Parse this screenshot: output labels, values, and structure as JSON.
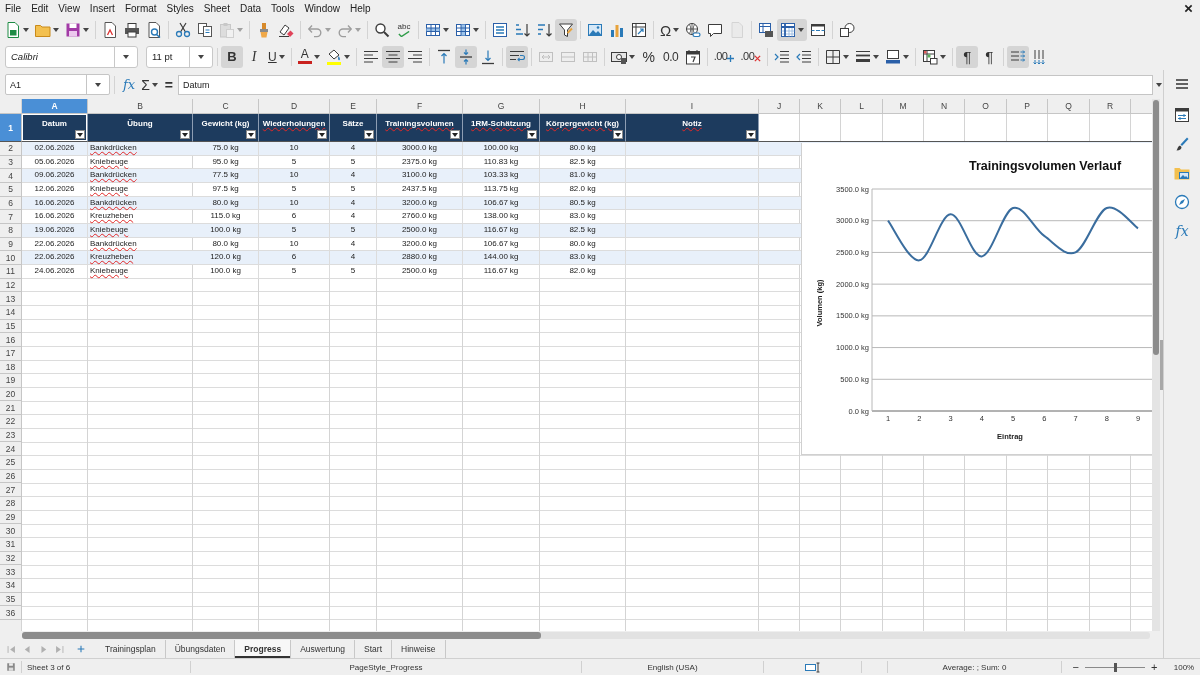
{
  "menu_bar": [
    "File",
    "Edit",
    "View",
    "Insert",
    "Format",
    "Styles",
    "Sheet",
    "Data",
    "Tools",
    "Window",
    "Help"
  ],
  "standard_toolbar": [
    [
      {
        "kind": "new",
        "on": false,
        "disabled": false
      },
      {
        "kind": "open",
        "on": false,
        "disabled": false
      },
      {
        "kind": "save",
        "on": false,
        "disabled": false
      }
    ],
    [
      {
        "kind": "export_pdf",
        "on": false,
        "disabled": false
      },
      {
        "kind": "print",
        "on": false,
        "disabled": false
      },
      {
        "kind": "print_preview",
        "on": false,
        "disabled": false
      }
    ],
    [
      {
        "kind": "cut",
        "on": false,
        "disabled": false
      },
      {
        "kind": "copy",
        "on": false,
        "disabled": false
      },
      {
        "kind": "paste",
        "on": false,
        "disabled": true
      }
    ],
    [
      {
        "kind": "clone_formatting",
        "on": false,
        "disabled": false
      },
      {
        "kind": "clear_formatting",
        "on": false,
        "disabled": false
      }
    ],
    [
      {
        "kind": "undo",
        "on": false,
        "disabled": true
      },
      {
        "kind": "redo",
        "on": false,
        "disabled": true
      }
    ],
    [
      {
        "kind": "find_replace",
        "on": false,
        "disabled": false
      },
      {
        "kind": "spelling",
        "glyph": "abc",
        "on": false,
        "disabled": false
      }
    ],
    [
      {
        "kind": "row",
        "on": false,
        "disabled": false
      },
      {
        "kind": "column",
        "on": false,
        "disabled": false
      }
    ],
    [
      {
        "kind": "sort",
        "on": false,
        "disabled": false
      },
      {
        "kind": "sort_ascending",
        "on": false,
        "disabled": false
      },
      {
        "kind": "sort_descending",
        "on": false,
        "disabled": false
      },
      {
        "kind": "autofilter",
        "on": true,
        "disabled": false
      }
    ],
    [
      {
        "kind": "image",
        "on": false,
        "disabled": false
      },
      {
        "kind": "chart",
        "on": false,
        "disabled": false
      },
      {
        "kind": "pivot_table",
        "on": false,
        "disabled": false
      }
    ],
    [
      {
        "kind": "special_character",
        "glyph": "Ω",
        "on": false,
        "disabled": false
      },
      {
        "kind": "hyperlink",
        "on": false,
        "disabled": false
      },
      {
        "kind": "comment",
        "on": false,
        "disabled": false
      },
      {
        "kind": "header_footer",
        "on": false,
        "disabled": true
      }
    ],
    [
      {
        "kind": "print_area",
        "on": false,
        "disabled": false
      },
      {
        "kind": "freeze",
        "on": true,
        "disabled": false
      },
      {
        "kind": "split_window",
        "on": false,
        "disabled": false
      }
    ],
    [
      {
        "kind": "draw_functions",
        "on": false,
        "disabled": false
      }
    ]
  ],
  "formatting_toolbar": {
    "font_name": "Calibri",
    "font_size": "11 pt",
    "groups": [
      [
        {
          "kind": "bold",
          "glyph": "B",
          "on": true,
          "disabled": false
        },
        {
          "kind": "italic",
          "glyph": "I",
          "on": false,
          "disabled": false
        },
        {
          "kind": "underline",
          "glyph": "U",
          "on": false,
          "disabled": false
        }
      ],
      [
        {
          "kind": "font_color",
          "glyph": "A",
          "color": "#c9211e",
          "on": false,
          "disabled": false
        },
        {
          "kind": "highlight",
          "color": "#ffff00",
          "on": false,
          "disabled": false
        }
      ],
      [
        {
          "kind": "align_left",
          "on": false,
          "disabled": false
        },
        {
          "kind": "align_center",
          "on": true,
          "disabled": false
        },
        {
          "kind": "align_right",
          "on": false,
          "disabled": false
        }
      ],
      [
        {
          "kind": "align_top",
          "on": false,
          "disabled": false
        },
        {
          "kind": "align_middle",
          "on": true,
          "disabled": false
        },
        {
          "kind": "align_bottom",
          "on": false,
          "disabled": false
        }
      ],
      [
        {
          "kind": "wrap_text",
          "on": true,
          "disabled": false
        }
      ],
      [
        {
          "kind": "merge_center",
          "on": false,
          "disabled": true
        },
        {
          "kind": "merge",
          "on": false,
          "disabled": true
        },
        {
          "kind": "unmerge",
          "on": false,
          "disabled": true
        }
      ],
      [
        {
          "kind": "number_format",
          "on": false,
          "disabled": false
        },
        {
          "kind": "percent",
          "glyph": "%",
          "on": false,
          "disabled": false
        },
        {
          "kind": "number",
          "glyph": "0.0",
          "on": false,
          "disabled": false
        },
        {
          "kind": "date",
          "on": false,
          "disabled": false
        }
      ],
      [
        {
          "kind": "add_decimal",
          "glyph": ".00",
          "on": false,
          "disabled": false
        },
        {
          "kind": "delete_decimal",
          "glyph": ".00",
          "on": false,
          "disabled": false
        }
      ],
      [
        {
          "kind": "indent",
          "on": false,
          "disabled": false
        },
        {
          "kind": "outdent",
          "on": false,
          "disabled": false
        }
      ],
      [
        {
          "kind": "borders",
          "on": false,
          "disabled": false
        },
        {
          "kind": "border_style",
          "on": false,
          "disabled": false
        },
        {
          "kind": "border_color",
          "on": false,
          "disabled": false
        }
      ],
      [
        {
          "kind": "conditional",
          "on": false,
          "disabled": false
        }
      ],
      [
        {
          "kind": "ltr",
          "glyph": "¶",
          "on": true,
          "disabled": false
        },
        {
          "kind": "rtl",
          "glyph": "¶",
          "on": false,
          "disabled": false
        }
      ],
      [
        {
          "kind": "text_horizontal",
          "on": true,
          "disabled": false
        },
        {
          "kind": "text_vertical",
          "on": false,
          "disabled": false
        }
      ]
    ]
  },
  "formula_bar": {
    "cell_reference": "A1",
    "function_wizard": "fx",
    "sum": "Σ",
    "formula": "=",
    "content": "Datum"
  },
  "sheet": {
    "columns": [
      {
        "letter": "A",
        "selected": true
      },
      {
        "letter": "B",
        "selected": false
      },
      {
        "letter": "C",
        "selected": false
      },
      {
        "letter": "D",
        "selected": false
      },
      {
        "letter": "E",
        "selected": false
      },
      {
        "letter": "F",
        "selected": false
      },
      {
        "letter": "G",
        "selected": false
      },
      {
        "letter": "H",
        "selected": false
      },
      {
        "letter": "I",
        "selected": false
      },
      {
        "letter": "J",
        "selected": false
      },
      {
        "letter": "K",
        "selected": false
      },
      {
        "letter": "L",
        "selected": false
      },
      {
        "letter": "M",
        "selected": false
      },
      {
        "letter": "N",
        "selected": false
      },
      {
        "letter": "O",
        "selected": false
      },
      {
        "letter": "P",
        "selected": false
      },
      {
        "letter": "Q",
        "selected": false
      },
      {
        "letter": "R",
        "selected": false
      }
    ],
    "header_row": {
      "row_number": "1",
      "selected": true,
      "cells": [
        {
          "text": "Datum",
          "misspelled": false
        },
        {
          "text": "Übung",
          "misspelled": false
        },
        {
          "text": "Gewicht (kg)",
          "misspelled": false
        },
        {
          "text": "Wiederholungen",
          "misspelled": true
        },
        {
          "text": "Sätze",
          "misspelled": false
        },
        {
          "text": "Trainingsvolumen",
          "misspelled": true
        },
        {
          "text": "1RM-Schätzung",
          "misspelled": true
        },
        {
          "text": "Körpergewicht (kg)",
          "misspelled": true
        },
        {
          "text": "Notiz",
          "misspelled": true
        }
      ]
    },
    "rows": [
      {
        "row_number": "2",
        "cells": [
          {
            "text": "02.06.2026",
            "misspelled": false
          },
          {
            "text": "Bankdrücken",
            "misspelled": true
          },
          {
            "text": "75.0 kg",
            "misspelled": false
          },
          {
            "text": "10",
            "misspelled": false
          },
          {
            "text": "4",
            "misspelled": false
          },
          {
            "text": "3000.0 kg",
            "misspelled": false
          },
          {
            "text": "100.00 kg",
            "misspelled": false
          },
          {
            "text": "80.0 kg",
            "misspelled": false
          }
        ]
      },
      {
        "row_number": "3",
        "cells": [
          {
            "text": "05.06.2026",
            "misspelled": false
          },
          {
            "text": "Kniebeuge",
            "misspelled": true
          },
          {
            "text": "95.0 kg",
            "misspelled": false
          },
          {
            "text": "5",
            "misspelled": false
          },
          {
            "text": "5",
            "misspelled": false
          },
          {
            "text": "2375.0 kg",
            "misspelled": false
          },
          {
            "text": "110.83 kg",
            "misspelled": false
          },
          {
            "text": "82.5 kg",
            "misspelled": false
          }
        ]
      },
      {
        "row_number": "4",
        "cells": [
          {
            "text": "09.06.2026",
            "misspelled": false
          },
          {
            "text": "Bankdrücken",
            "misspelled": true
          },
          {
            "text": "77.5 kg",
            "misspelled": false
          },
          {
            "text": "10",
            "misspelled": false
          },
          {
            "text": "4",
            "misspelled": false
          },
          {
            "text": "3100.0 kg",
            "misspelled": false
          },
          {
            "text": "103.33 kg",
            "misspelled": false
          },
          {
            "text": "81.0 kg",
            "misspelled": false
          }
        ]
      },
      {
        "row_number": "5",
        "cells": [
          {
            "text": "12.06.2026",
            "misspelled": false
          },
          {
            "text": "Kniebeuge",
            "misspelled": true
          },
          {
            "text": "97.5 kg",
            "misspelled": false
          },
          {
            "text": "5",
            "misspelled": false
          },
          {
            "text": "5",
            "misspelled": false
          },
          {
            "text": "2437.5 kg",
            "misspelled": false
          },
          {
            "text": "113.75 kg",
            "misspelled": false
          },
          {
            "text": "82.0 kg",
            "misspelled": false
          }
        ]
      },
      {
        "row_number": "6",
        "cells": [
          {
            "text": "16.06.2026",
            "misspelled": false
          },
          {
            "text": "Bankdrücken",
            "misspelled": true
          },
          {
            "text": "80.0 kg",
            "misspelled": false
          },
          {
            "text": "10",
            "misspelled": false
          },
          {
            "text": "4",
            "misspelled": false
          },
          {
            "text": "3200.0 kg",
            "misspelled": false
          },
          {
            "text": "106.67 kg",
            "misspelled": false
          },
          {
            "text": "80.5 kg",
            "misspelled": false
          }
        ]
      },
      {
        "row_number": "7",
        "cells": [
          {
            "text": "16.06.2026",
            "misspelled": false
          },
          {
            "text": "Kreuzheben",
            "misspelled": true
          },
          {
            "text": "115.0 kg",
            "misspelled": false
          },
          {
            "text": "6",
            "misspelled": false
          },
          {
            "text": "4",
            "misspelled": false
          },
          {
            "text": "2760.0 kg",
            "misspelled": false
          },
          {
            "text": "138.00 kg",
            "misspelled": false
          },
          {
            "text": "83.0 kg",
            "misspelled": false
          }
        ]
      },
      {
        "row_number": "8",
        "cells": [
          {
            "text": "19.06.2026",
            "misspelled": false
          },
          {
            "text": "Kniebeuge",
            "misspelled": true
          },
          {
            "text": "100.0 kg",
            "misspelled": false
          },
          {
            "text": "5",
            "misspelled": false
          },
          {
            "text": "5",
            "misspelled": false
          },
          {
            "text": "2500.0 kg",
            "misspelled": false
          },
          {
            "text": "116.67 kg",
            "misspelled": false
          },
          {
            "text": "82.5 kg",
            "misspelled": false
          }
        ]
      },
      {
        "row_number": "9",
        "cells": [
          {
            "text": "22.06.2026",
            "misspelled": false
          },
          {
            "text": "Bankdrücken",
            "misspelled": true
          },
          {
            "text": "80.0 kg",
            "misspelled": false
          },
          {
            "text": "10",
            "misspelled": false
          },
          {
            "text": "4",
            "misspelled": false
          },
          {
            "text": "3200.0 kg",
            "misspelled": false
          },
          {
            "text": "106.67 kg",
            "misspelled": false
          },
          {
            "text": "80.0 kg",
            "misspelled": false
          }
        ]
      },
      {
        "row_number": "10",
        "cells": [
          {
            "text": "22.06.2026",
            "misspelled": false
          },
          {
            "text": "Kreuzheben",
            "misspelled": true
          },
          {
            "text": "120.0 kg",
            "misspelled": false
          },
          {
            "text": "6",
            "misspelled": false
          },
          {
            "text": "4",
            "misspelled": false
          },
          {
            "text": "2880.0 kg",
            "misspelled": false
          },
          {
            "text": "144.00 kg",
            "misspelled": false
          },
          {
            "text": "83.0 kg",
            "misspelled": false
          }
        ]
      },
      {
        "row_number": "11",
        "cells": [
          {
            "text": "24.06.2026",
            "misspelled": false
          },
          {
            "text": "Kniebeuge",
            "misspelled": true
          },
          {
            "text": "100.0 kg",
            "misspelled": false
          },
          {
            "text": "5",
            "misspelled": false
          },
          {
            "text": "5",
            "misspelled": false
          },
          {
            "text": "2500.0 kg",
            "misspelled": false
          },
          {
            "text": "116.67 kg",
            "misspelled": false
          },
          {
            "text": "82.0 kg",
            "misspelled": false
          }
        ]
      }
    ],
    "empty_row_numbers": [
      "12",
      "13",
      "14",
      "15",
      "16",
      "17",
      "18",
      "19",
      "20",
      "21",
      "22",
      "23",
      "24",
      "25",
      "26",
      "27",
      "28",
      "29",
      "30",
      "31",
      "32",
      "33",
      "34",
      "35",
      "36"
    ],
    "chart": {
      "chart_data": {
        "type": "line",
        "title": "Trainingsvolumen Verlauf",
        "xlabel": "Eintrag",
        "ylabel": "Volumen (kg)",
        "categories": [
          "1",
          "2",
          "3",
          "4",
          "5",
          "6",
          "7",
          "8",
          "9"
        ],
        "series": [
          {
            "color": "#3a6d9e",
            "values": [
              3000,
              2375,
              3100,
              2437.5,
              3200,
              2760,
              2500,
              3200,
              2880
            ]
          }
        ],
        "ylim": [
          0,
          3500
        ],
        "yticks": [
          {
            "value": 0,
            "label": "0.0 kg"
          },
          {
            "value": 500,
            "label": "500.0 kg"
          },
          {
            "value": 1000,
            "label": "1000.0 kg"
          },
          {
            "value": 1500,
            "label": "1500.0 kg"
          },
          {
            "value": 2000,
            "label": "2000.0 kg"
          },
          {
            "value": 2500,
            "label": "2500.0 kg"
          },
          {
            "value": 3000,
            "label": "3000.0 kg"
          },
          {
            "value": 3500,
            "label": "3500.0 kg"
          }
        ],
        "grid": true
      }
    }
  },
  "sheet_navigation": [
    {
      "kind": "first",
      "disabled": true
    },
    {
      "kind": "previous",
      "disabled": true
    },
    {
      "kind": "next",
      "disabled": true
    },
    {
      "kind": "last",
      "disabled": true
    }
  ],
  "sheet_tabs": [
    {
      "label": "Trainingsplan",
      "selected": false
    },
    {
      "label": "Übungsdaten",
      "selected": false
    },
    {
      "label": "Progress",
      "selected": true
    },
    {
      "label": "Auswertung",
      "selected": false
    },
    {
      "label": "Start",
      "selected": false
    },
    {
      "label": "Hinweise",
      "selected": false
    }
  ],
  "sidebar": {
    "decks": [
      {
        "kind": "properties"
      },
      {
        "kind": "styles"
      },
      {
        "kind": "gallery"
      },
      {
        "kind": "navigator"
      },
      {
        "kind": "functions",
        "glyph": "fx"
      }
    ]
  },
  "status_bar": {
    "sheet_info": "Sheet 3 of 6",
    "page_style": "PageStyle_Progress",
    "language": "English (USA)",
    "summary": "Average: ; Sum: 0",
    "zoom_out": "−",
    "zoom_slider": {
      "level": 0.5
    },
    "zoom_in": "+",
    "zoom": "100%"
  }
}
